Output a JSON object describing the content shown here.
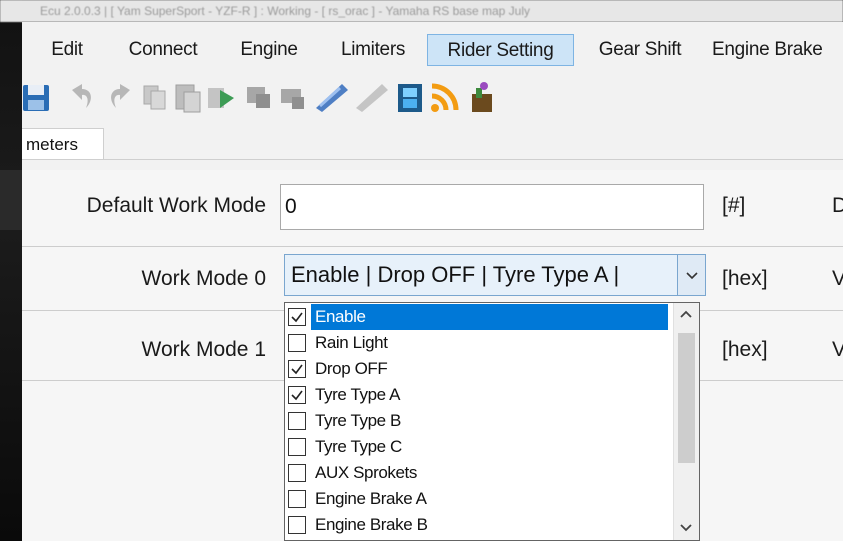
{
  "window": {
    "title_partial": "Ecu 2.0.0.3 | [ Yam SuperSport - YZF-R ] : Working - [ rs_orac ] - Yamaha RS base map July"
  },
  "menu": {
    "items": [
      "Edit",
      "Connect",
      "Engine",
      "Limiters",
      "Rider Setting",
      "Gear Shift",
      "Engine Brake"
    ],
    "active": "Rider Setting"
  },
  "toolbar": {
    "icons": [
      "save-icon",
      "undo-icon",
      "redo-icon",
      "copy-icon",
      "paste-icon",
      "compare-icon",
      "map-down-icon",
      "map-up-icon",
      "flash-write-icon",
      "flash-read-icon",
      "film-icon",
      "feed-icon",
      "tool-icon"
    ]
  },
  "tab": {
    "label": "meters"
  },
  "fields": {
    "default_work_mode": {
      "label": "Default Work Mode",
      "value": "0",
      "unit": "[#]",
      "next_col_cut": "D"
    },
    "work_mode_0": {
      "label": "Work Mode 0",
      "value": "Enable | Drop OFF | Tyre Type A |",
      "unit": "[hex]",
      "next_col_cut": "V"
    },
    "work_mode_1": {
      "label": "Work Mode 1",
      "unit": "[hex]",
      "next_col_cut": "V"
    }
  },
  "dropdown": {
    "options": [
      {
        "label": "Enable",
        "checked": true,
        "selected": true
      },
      {
        "label": "Rain Light",
        "checked": false,
        "selected": false
      },
      {
        "label": "Drop OFF",
        "checked": true,
        "selected": false
      },
      {
        "label": "Tyre Type A",
        "checked": true,
        "selected": false
      },
      {
        "label": "Tyre Type B",
        "checked": false,
        "selected": false
      },
      {
        "label": "Tyre Type C",
        "checked": false,
        "selected": false
      },
      {
        "label": "AUX Sprokets",
        "checked": false,
        "selected": false
      },
      {
        "label": "Engine Brake A",
        "checked": false,
        "selected": false
      },
      {
        "label": "Engine Brake B",
        "checked": false,
        "selected": false
      }
    ]
  },
  "colors": {
    "selection": "#0078d7",
    "menu_active_bg": "#cde4f7",
    "combo_bg": "#e7f1fa"
  }
}
